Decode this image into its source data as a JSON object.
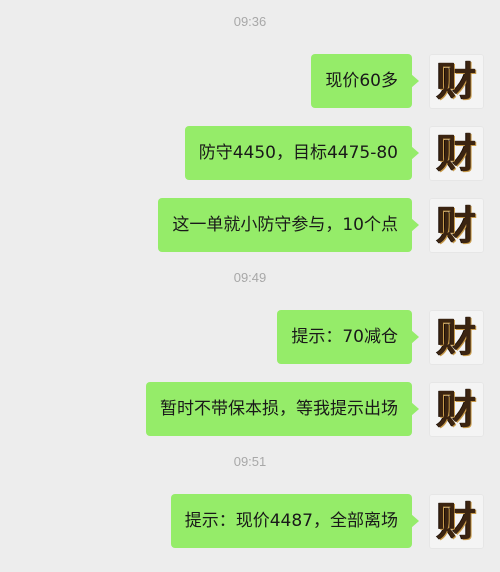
{
  "chat": {
    "timestamps": [
      "09:36",
      "09:49",
      "09:51"
    ],
    "messages": [
      {
        "text": "现价60多",
        "avatar": "财"
      },
      {
        "text": "防守4450，目标4475-80",
        "avatar": "财"
      },
      {
        "text": "这一单就小防守参与，10个点",
        "avatar": "财"
      },
      {
        "text": "提示：70减仓",
        "avatar": "财"
      },
      {
        "text": "暂时不带保本损，等我提示出场",
        "avatar": "财"
      },
      {
        "text": "提示：现价4487，全部离场",
        "avatar": "财"
      }
    ]
  },
  "colors": {
    "background": "#ededed",
    "bubble": "#95ec69",
    "timestamp": "#a8a8a8",
    "text": "#191919"
  }
}
